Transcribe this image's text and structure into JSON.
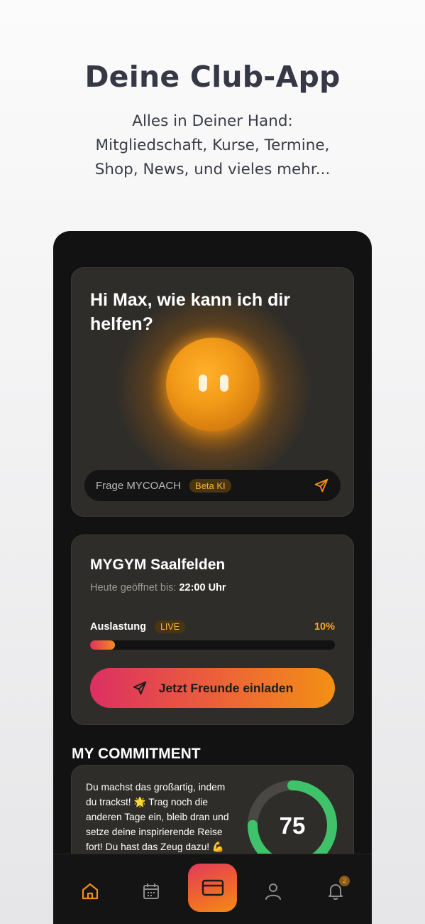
{
  "hero": {
    "title": "Deine Club-App",
    "subtitle_lines": [
      "Alles in Deiner Hand:",
      "Mitgliedschaft, Kurse, Termine,",
      "Shop, News, und vieles mehr..."
    ]
  },
  "coach": {
    "greeting_line1": "Hi Max, wie kann ich dir",
    "greeting_line2": "helfen?",
    "input_placeholder": "Frage MYCOACH",
    "beta_badge": "Beta KI",
    "send_icon": "send-icon"
  },
  "gym": {
    "name": "MYGYM Saalfelden",
    "hours_label": "Heute geöffnet bis:",
    "hours_value": "22:00 Uhr",
    "load_label": "Auslastung",
    "live_badge": "LIVE",
    "load_percent_text": "10%",
    "load_fraction": 0.1,
    "invite_button": "Jetzt Freunde einladen"
  },
  "commitment": {
    "section_title": "MY COMMITMENT",
    "text_lines": [
      "Du machst das großartig, indem",
      "du trackst! 🌟  Trag noch die",
      "anderen Tage ein, bleib dran und",
      "setze deine inspirierende Reise",
      "fort! Du hast das Zeug dazu! 💪"
    ],
    "score": "75",
    "score_fraction": 0.75,
    "ring_color": "#3fc36a"
  },
  "nav": {
    "items": [
      "home-icon",
      "calendar-icon",
      "membership-card-icon",
      "profile-icon",
      "bell-icon"
    ],
    "notification_count": "2",
    "accent": "#f39014"
  }
}
